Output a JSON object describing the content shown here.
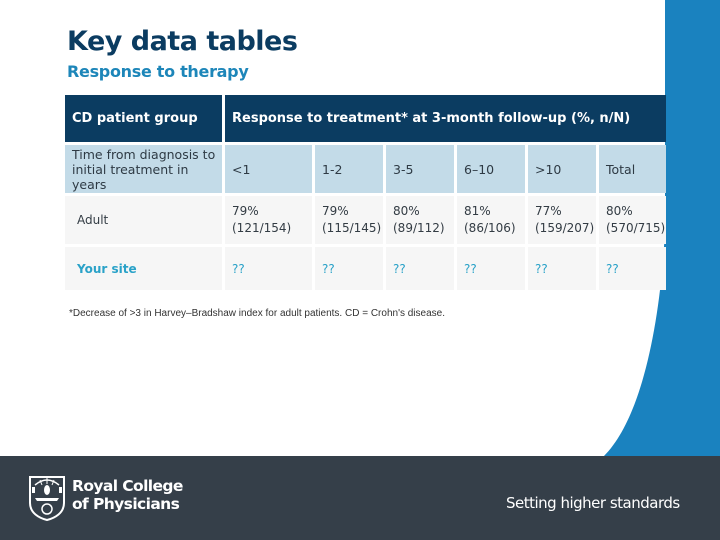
{
  "header": {
    "title": "Key data tables",
    "subtitle": "Response to therapy"
  },
  "table": {
    "group_header": "CD patient group",
    "response_header": "Response to treatment* at 3-month follow-up (%, n/N)",
    "time_label": "Time from diagnosis to initial treatment in years",
    "columns": [
      "<1",
      "1-2",
      "3-5",
      "6–10",
      ">10",
      "Total"
    ],
    "rows": [
      {
        "label": "Adult",
        "cells": [
          {
            "pct": "79%",
            "n": "(121/154)"
          },
          {
            "pct": "79%",
            "n": "(115/145)"
          },
          {
            "pct": "80%",
            "n": "(89/112)"
          },
          {
            "pct": "81%",
            "n": "(86/106)"
          },
          {
            "pct": "77%",
            "n": "(159/207)"
          },
          {
            "pct": "80%",
            "n": "(570/715)"
          }
        ]
      },
      {
        "label": "Your site",
        "cells": [
          "??",
          "??",
          "??",
          "??",
          "??",
          "??"
        ]
      }
    ]
  },
  "footnote": "*Decrease of >3 in Harvey–Bradshaw index for adult patients. CD = Crohn's disease.",
  "footer": {
    "org_line1": "Royal College",
    "org_line2": "of Physicians",
    "tagline": "Setting higher standards"
  },
  "colors": {
    "navy": "#0b3c61",
    "accent_blue": "#1d86b9",
    "light_blue": "#c3dbe8",
    "site_text": "#2aa2c8",
    "footer_bg": "#353f49"
  }
}
